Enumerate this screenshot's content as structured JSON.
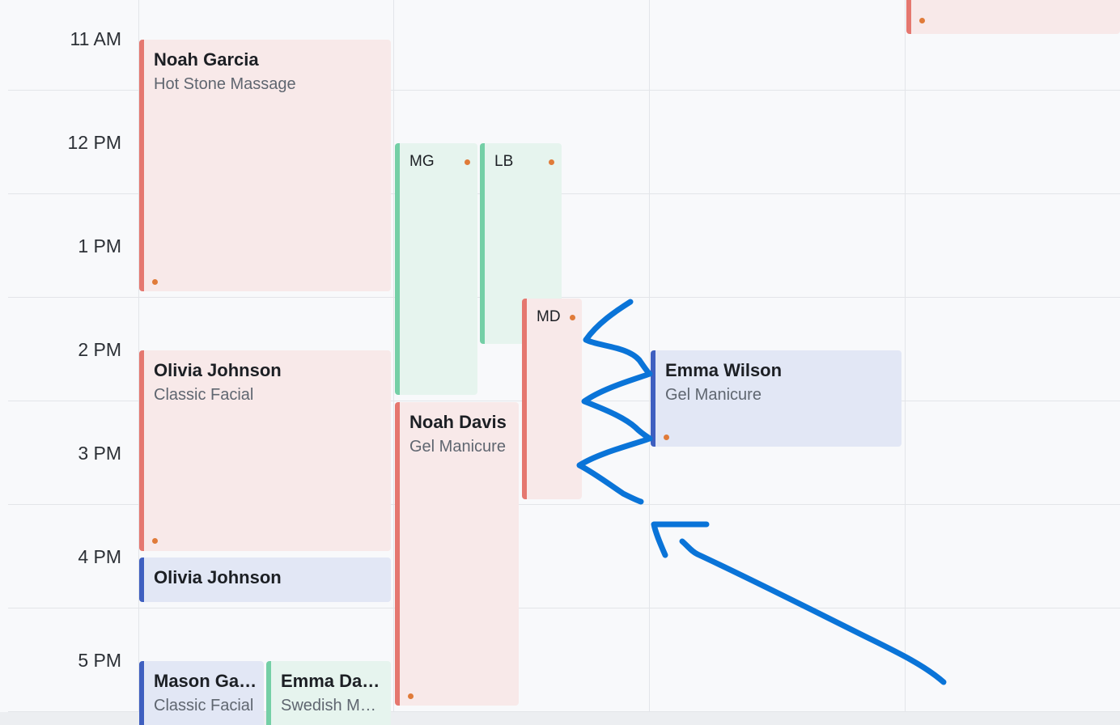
{
  "times": [
    "11 AM",
    "12 PM",
    "1 PM",
    "2 PM",
    "3 PM",
    "4 PM",
    "5 PM"
  ],
  "events": {
    "noah_garcia": {
      "name": "Noah Garcia",
      "service": "Hot Stone Massage"
    },
    "mg": {
      "initials": "MG"
    },
    "lb": {
      "initials": "LB"
    },
    "md": {
      "initials": "MD"
    },
    "emma_wilson": {
      "name": "Emma Wilson",
      "service": "Gel Manicure"
    },
    "olivia_johnson_1": {
      "name": "Olivia Johnson",
      "service": "Classic Facial"
    },
    "noah_davis": {
      "name": "Noah Davis",
      "service": "Gel Manicure"
    },
    "olivia_johnson_2": {
      "name": "Olivia Johnson"
    },
    "mason": {
      "name": "Mason Garcia",
      "service": "Classic Facial"
    },
    "emma_davis": {
      "name": "Emma Davis",
      "service": "Swedish Massage"
    }
  },
  "colors": {
    "red_accent": "#e5776f",
    "green_accent": "#74cfa6",
    "blue_accent": "#3f5fc0",
    "status_dot": "#e07b39",
    "annotation": "#0a74d8"
  }
}
